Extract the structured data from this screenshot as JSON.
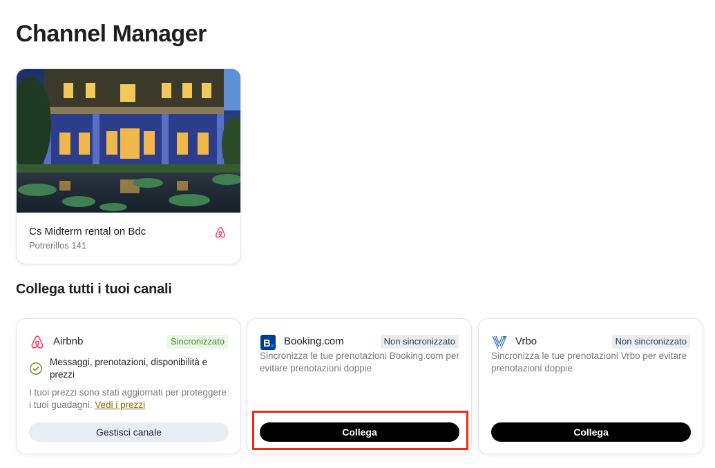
{
  "page": {
    "title": "Channel Manager"
  },
  "listing": {
    "name": "Cs Midterm rental on Bdc",
    "address": "Potrerillos 141",
    "channel_icon": "airbnb-icon"
  },
  "connect_section": {
    "title": "Collega tutti i tuoi canali"
  },
  "channels": [
    {
      "name": "Airbnb",
      "icon": "airbnb-icon",
      "status": "Sincronizzato",
      "feature": "Messaggi, prenotazioni, disponibilità e prezzi",
      "note": "I tuoi prezzi sono stati aggiornati per proteggere i tuoi guadagni.",
      "note_link": "Vedi i prezzi",
      "button": "Gestisci canale"
    },
    {
      "name": "Booking.com",
      "icon": "booking-icon",
      "status": "Non sincronizzato",
      "description": "Sincronizza le tue prenotazioni Booking.com per evitare prenotazioni doppie",
      "button": "Collega"
    },
    {
      "name": "Vrbo",
      "icon": "vrbo-icon",
      "status": "Non sincronizzato",
      "description": "Sincronizza le tue prenotazioni Vrbo per evitare prenotazioni doppie",
      "button": "Collega"
    }
  ],
  "colors": {
    "airbnb": "#ff385c",
    "booking": "#003b95",
    "vrbo": "#1d5fbf",
    "synced_badge_text": "#3f8a2d",
    "primary_button": "#000000",
    "highlight": "#f12a12"
  }
}
